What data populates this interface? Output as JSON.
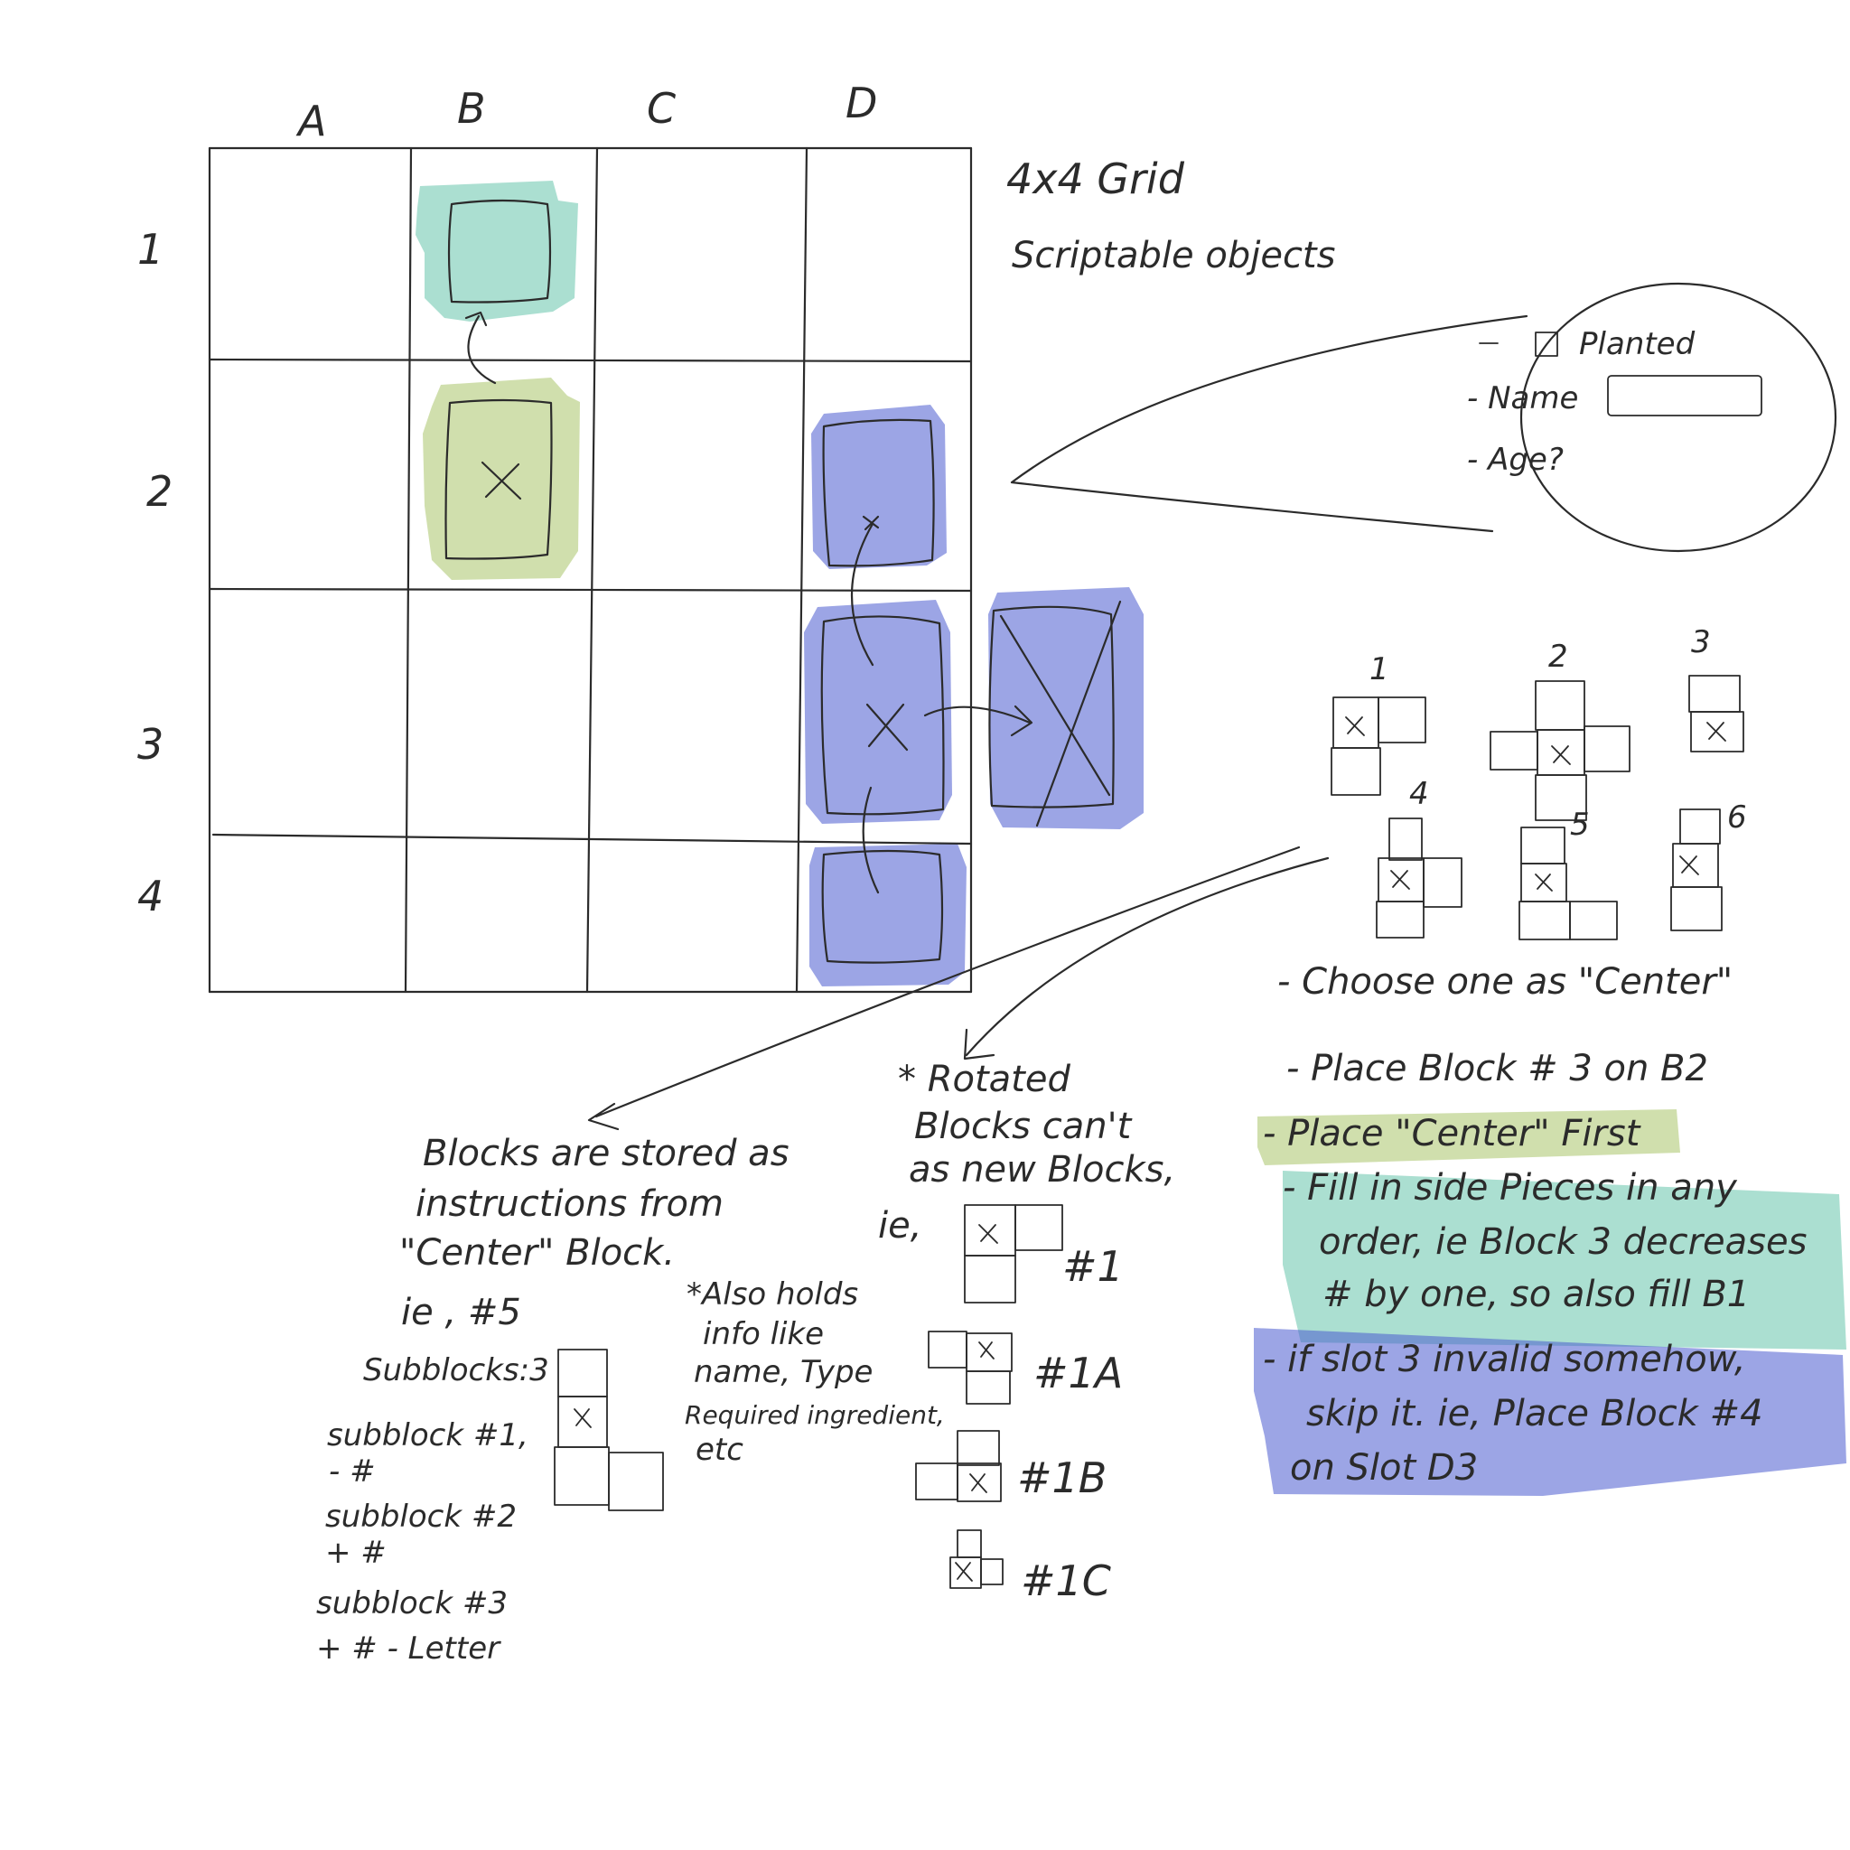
{
  "grid": {
    "columns": [
      "A",
      "B",
      "C",
      "D"
    ],
    "rows": [
      "1",
      "2",
      "3",
      "4"
    ]
  },
  "notes": {
    "grid_title": "4x4 Grid",
    "scriptable": "Scriptable objects"
  },
  "popup": {
    "planted": "Planted",
    "name": "- Name",
    "age": "- Age?"
  },
  "block_numbers": [
    "1",
    "2",
    "3",
    "4",
    "5",
    "6"
  ],
  "rules": [
    "- Choose one as \"Center\"",
    "- Place Block # 3 on B2",
    "- Place \"Center\" First",
    "- Fill in side Pieces in any",
    "order, ie Block 3 decreases",
    "# by one, so also fill B1",
    "- if slot 3 invalid somehow,",
    "skip it. ie, Place Block #4",
    "on Slot D3"
  ],
  "stored": [
    "Blocks are stored as",
    "instructions from",
    "\"Center\" Block.",
    "ie , #5",
    "Subblocks:3",
    "subblock #1,",
    "- #",
    "subblock #2",
    "+ #",
    "subblock #3",
    "+ # - Letter"
  ],
  "also_holds": [
    "*Also holds",
    "info like",
    "name, Type",
    "Required ingredient,",
    "etc"
  ],
  "rotated": [
    "* Rotated",
    "Blocks can't",
    "as new Blocks,",
    "ie,"
  ],
  "rotated_labels": [
    "#1",
    "#1A",
    "#1B",
    "#1C"
  ],
  "colors": {
    "ink": "#2b2b2b",
    "green": "#a9c46a",
    "teal": "#58bfa3",
    "blue": "#4a5bd0"
  }
}
